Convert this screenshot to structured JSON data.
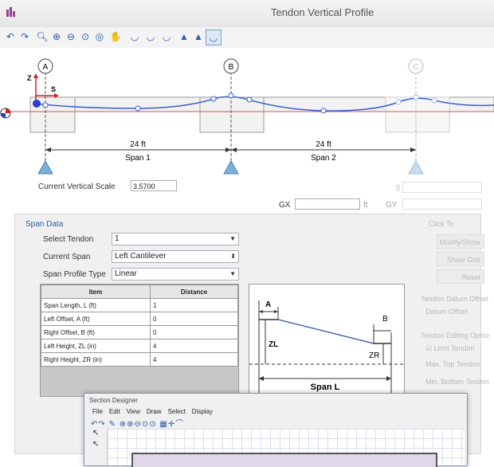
{
  "window": {
    "title": "Tendon Vertical Profile"
  },
  "diagram": {
    "grid_a": "A",
    "grid_b": "B",
    "grid_c": "C",
    "axis_z": "Z",
    "axis_s": "S",
    "span1_length": "24 ft",
    "span1_name": "Span 1",
    "span2_length": "24 ft",
    "span2_name": "Span 2"
  },
  "scale": {
    "label": "Current Vertical Scale",
    "value": "3.5700"
  },
  "coords": {
    "gx_label": "GX",
    "gx_unit": "ft",
    "gy_label": "GY",
    "s_label": "S"
  },
  "span_data": {
    "title": "Span Data",
    "select_tendon_label": "Select Tendon",
    "select_tendon_value": "1",
    "current_span_label": "Current Span",
    "current_span_value": "Left Cantilever",
    "profile_type_label": "Span Profile Type",
    "profile_type_value": "Linear",
    "table_headers": [
      "Item",
      "Distance"
    ],
    "rows": [
      [
        "Span Length, L  (ft)",
        "1"
      ],
      [
        "Left Offset, A  (ft)",
        "0"
      ],
      [
        "Right Offset, B  (ft)",
        "0"
      ],
      [
        "Left Height, ZL  (in)",
        "4"
      ],
      [
        "Right Height, ZR  (in)",
        "4"
      ]
    ]
  },
  "sketch": {
    "a": "A",
    "b": "B",
    "zl": "ZL",
    "zr": "ZR",
    "span_l": "Span L"
  },
  "right_panel": {
    "click_to": "Click To",
    "modify_btn": "Modify/Show",
    "show_btn": "Show Grid",
    "reset_btn": "Reset",
    "datum_group": "Tendon Datum Offset",
    "datum_offset": "Datum Offset",
    "editing_group": "Tendon Editing Options",
    "limit_tendon": "Limit Tendon",
    "max_top": "Max. Top Tendon",
    "min_bottom": "Min. Bottom Tendon"
  },
  "section_designer": {
    "title": "Section Designer",
    "menu": [
      "File",
      "Edit",
      "View",
      "Draw",
      "Select",
      "Display"
    ]
  },
  "colors": {
    "tendon": "#3a5fd0",
    "accent": "#2a5ca8",
    "support": "#7ab0d8"
  }
}
